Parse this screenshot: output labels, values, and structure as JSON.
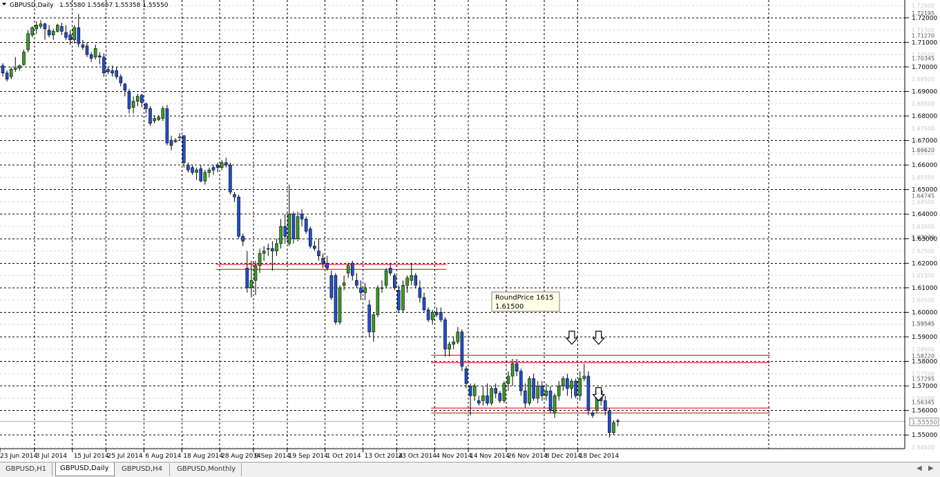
{
  "header": {
    "symbol": "GBPUSD,Daily",
    "ohlc": "1.55580 1.55657 1.55358 1.55550"
  },
  "tooltip": {
    "line1": "RoundPrice 1615",
    "line2": "1.61500"
  },
  "tabs": [
    {
      "label": "GBPUSD,H1",
      "active": false
    },
    {
      "label": "GBPUSD,Daily",
      "active": true
    },
    {
      "label": "GBPUSD,H4",
      "active": false
    },
    {
      "label": "GBPUSD,Monthly",
      "active": false
    }
  ],
  "colors": {
    "bull": "#3a9b26",
    "bear": "#1f4fd1",
    "wick": "#000000",
    "grid": "#000000",
    "level_line": "#cc0000"
  },
  "chart_data": {
    "type": "candlestick",
    "title": "GBPUSD,Daily",
    "ylim": [
      1.545,
      1.725
    ],
    "y_ticks_bold": [
      "1.72000",
      "1.71000",
      "1.70000",
      "1.69000",
      "1.68000",
      "1.67000",
      "1.66000",
      "1.65000",
      "1.64000",
      "1.63000",
      "1.62000",
      "1.61000",
      "1.60000",
      "1.59000",
      "1.58000",
      "1.57000",
      "1.56000",
      "1.55000"
    ],
    "y_ticks_faint": [
      "1.72500",
      "1.71500",
      "1.70500",
      "1.69500",
      "1.68500",
      "1.67500",
      "1.66500",
      "1.65500",
      "1.64500",
      "1.63500",
      "1.62500",
      "1.61500",
      "1.60500",
      "1.59500",
      "1.58500",
      "1.57500",
      "1.56500",
      "1.54500"
    ],
    "y_marker_labels": [
      "1.72195",
      "1.71270",
      "1.70345",
      "1.66620",
      "1.64745",
      "1.63070",
      "1.59545",
      "1.58220",
      "1.57295",
      "1.56345"
    ],
    "current_price": "1.55550",
    "x_tick_labels": [
      "23 Jun 2014",
      "3 Jul 2014",
      "15 Jul 2014",
      "25 Jul 2014",
      "6 Aug 2014",
      "18 Aug 2014",
      "28 Aug 2014",
      "9 Sep 2014",
      "19 Sep 2014",
      "1 Oct 2014",
      "13 Oct 2014",
      "23 Oct 2014",
      "4 Nov 2014",
      "14 Nov 2014",
      "26 Nov 2014",
      "8 Dec 2014",
      "18 Dec 2014"
    ],
    "horizontal_levels": [
      {
        "price": 1.6195,
        "from": "28 Aug 2014",
        "to": "4 Nov 2014"
      },
      {
        "price": 1.6175,
        "from": "28 Aug 2014",
        "to": "4 Nov 2014"
      },
      {
        "price": 1.5825,
        "from": "4 Nov 2014",
        "to": "18 Dec 2014"
      },
      {
        "price": 1.5795,
        "from": "4 Nov 2014",
        "to": "18 Dec 2014"
      },
      {
        "price": 1.561,
        "from": "4 Nov 2014",
        "to": "18 Dec 2014"
      },
      {
        "price": 1.559,
        "from": "4 Nov 2014",
        "to": "18 Dec 2014"
      }
    ],
    "arrows": [
      {
        "label": "down-arrow",
        "price": 1.5895,
        "at": "8 Dec 2014"
      },
      {
        "label": "down-arrow",
        "price": 1.5895,
        "at": "18 Dec 2014"
      },
      {
        "label": "down-arrow",
        "price": 1.5665,
        "at": "18 Dec 2014"
      }
    ],
    "ohlc": [
      [
        1.7005,
        1.7015,
        1.696,
        1.6975
      ],
      [
        1.6975,
        1.6985,
        1.694,
        1.695
      ],
      [
        1.696,
        1.7,
        1.695,
        1.699
      ],
      [
        1.699,
        1.704,
        1.698,
        1.6995
      ],
      [
        1.6995,
        1.701,
        1.6985,
        1.7005
      ],
      [
        1.701,
        1.707,
        1.7005,
        1.706
      ],
      [
        1.707,
        1.715,
        1.706,
        1.7135
      ],
      [
        1.713,
        1.7165,
        1.712,
        1.716
      ],
      [
        1.7155,
        1.7185,
        1.7135,
        1.717
      ],
      [
        1.7165,
        1.719,
        1.7155,
        1.7175
      ],
      [
        1.7175,
        1.718,
        1.711,
        1.7155
      ],
      [
        1.715,
        1.717,
        1.712,
        1.713
      ],
      [
        1.713,
        1.7155,
        1.711,
        1.7145
      ],
      [
        1.7145,
        1.7175,
        1.714,
        1.717
      ],
      [
        1.7165,
        1.718,
        1.713,
        1.7145
      ],
      [
        1.714,
        1.717,
        1.711,
        1.712
      ],
      [
        1.713,
        1.715,
        1.709,
        1.711
      ],
      [
        1.711,
        1.717,
        1.7095,
        1.716
      ],
      [
        1.716,
        1.7215,
        1.708,
        1.7095
      ],
      [
        1.709,
        1.711,
        1.707,
        1.708
      ],
      [
        1.7085,
        1.71,
        1.704,
        1.705
      ],
      [
        1.705,
        1.706,
        1.702,
        1.7035
      ],
      [
        1.704,
        1.709,
        1.703,
        1.7075
      ],
      [
        1.7045,
        1.706,
        1.701,
        1.704
      ],
      [
        1.704,
        1.7055,
        1.696,
        1.6975
      ],
      [
        1.699,
        1.7,
        1.697,
        1.698
      ],
      [
        1.6985,
        1.7005,
        1.696,
        1.6975
      ],
      [
        1.6985,
        1.7,
        1.695,
        1.696
      ],
      [
        1.696,
        1.697,
        1.692,
        1.6935
      ],
      [
        1.693,
        1.6935,
        1.688,
        1.6905
      ],
      [
        1.69,
        1.691,
        1.681,
        1.683
      ],
      [
        1.6835,
        1.688,
        1.681,
        1.686
      ],
      [
        1.686,
        1.689,
        1.684,
        1.688
      ],
      [
        1.6885,
        1.689,
        1.6835,
        1.6855
      ],
      [
        1.685,
        1.6855,
        1.681,
        1.683
      ],
      [
        1.683,
        1.684,
        1.676,
        1.677
      ],
      [
        1.678,
        1.68,
        1.677,
        1.679
      ],
      [
        1.6785,
        1.68,
        1.678,
        1.6795
      ],
      [
        1.679,
        1.684,
        1.678,
        1.683
      ],
      [
        1.683,
        1.6845,
        1.668,
        1.669
      ],
      [
        1.67,
        1.672,
        1.666,
        1.668
      ],
      [
        1.6695,
        1.671,
        1.669,
        1.67
      ],
      [
        1.6715,
        1.673,
        1.67,
        1.6715
      ],
      [
        1.672,
        1.672,
        1.659,
        1.661
      ],
      [
        1.66,
        1.661,
        1.657,
        1.658
      ],
      [
        1.659,
        1.66,
        1.656,
        1.657
      ],
      [
        1.657,
        1.659,
        1.654,
        1.658
      ],
      [
        1.6585,
        1.66,
        1.653,
        1.6535
      ],
      [
        1.6535,
        1.658,
        1.652,
        1.657
      ],
      [
        1.657,
        1.659,
        1.655,
        1.658
      ],
      [
        1.659,
        1.66,
        1.656,
        1.658
      ],
      [
        1.66,
        1.661,
        1.657,
        1.659
      ],
      [
        1.659,
        1.662,
        1.658,
        1.661
      ],
      [
        1.661,
        1.663,
        1.659,
        1.66
      ],
      [
        1.66,
        1.661,
        1.648,
        1.649
      ],
      [
        1.648,
        1.649,
        1.645,
        1.647
      ],
      [
        1.647,
        1.648,
        1.63,
        1.631
      ],
      [
        1.631,
        1.632,
        1.627,
        1.629
      ],
      [
        1.618,
        1.625,
        1.608,
        1.61
      ],
      [
        1.61,
        1.621,
        1.606,
        1.613
      ],
      [
        1.613,
        1.621,
        1.607,
        1.619
      ],
      [
        1.619,
        1.626,
        1.616,
        1.624
      ],
      [
        1.624,
        1.627,
        1.621,
        1.625
      ],
      [
        1.626,
        1.628,
        1.623,
        1.626
      ],
      [
        1.626,
        1.629,
        1.617,
        1.625
      ],
      [
        1.625,
        1.63,
        1.623,
        1.628
      ],
      [
        1.628,
        1.638,
        1.626,
        1.635
      ],
      [
        1.635,
        1.64,
        1.628,
        1.631
      ],
      [
        1.628,
        1.652,
        1.627,
        1.64
      ],
      [
        1.64,
        1.641,
        1.628,
        1.63
      ],
      [
        1.63,
        1.641,
        1.629,
        1.639
      ],
      [
        1.64,
        1.642,
        1.635,
        1.638
      ],
      [
        1.638,
        1.639,
        1.632,
        1.633
      ],
      [
        1.634,
        1.635,
        1.626,
        1.627
      ],
      [
        1.627,
        1.629,
        1.625,
        1.626
      ],
      [
        1.625,
        1.63,
        1.621,
        1.623
      ],
      [
        1.622,
        1.624,
        1.618,
        1.62
      ],
      [
        1.62,
        1.623,
        1.617,
        1.618
      ],
      [
        1.615,
        1.617,
        1.605,
        1.606
      ],
      [
        1.615,
        1.616,
        1.595,
        1.596
      ],
      [
        1.596,
        1.611,
        1.595,
        1.61
      ],
      [
        1.611,
        1.615,
        1.609,
        1.612
      ],
      [
        1.616,
        1.62,
        1.614,
        1.619
      ],
      [
        1.62,
        1.621,
        1.613,
        1.615
      ],
      [
        1.613,
        1.616,
        1.61,
        1.611
      ],
      [
        1.61,
        1.613,
        1.605,
        1.608
      ],
      [
        1.608,
        1.612,
        1.605,
        1.61
      ],
      [
        1.603,
        1.605,
        1.59,
        1.592
      ],
      [
        1.592,
        1.6,
        1.588,
        1.599
      ],
      [
        1.599,
        1.611,
        1.598,
        1.61
      ],
      [
        1.61,
        1.613,
        1.608,
        1.61
      ],
      [
        1.611,
        1.618,
        1.61,
        1.617
      ],
      [
        1.618,
        1.62,
        1.615,
        1.616
      ],
      [
        1.615,
        1.616,
        1.609,
        1.61
      ],
      [
        1.609,
        1.611,
        1.6,
        1.601
      ],
      [
        1.601,
        1.613,
        1.6,
        1.611
      ],
      [
        1.611,
        1.615,
        1.608,
        1.614
      ],
      [
        1.613,
        1.62,
        1.611,
        1.615
      ],
      [
        1.615,
        1.616,
        1.61,
        1.611
      ],
      [
        1.61,
        1.613,
        1.604,
        1.606
      ],
      [
        1.606,
        1.608,
        1.6,
        1.601
      ],
      [
        1.601,
        1.602,
        1.596,
        1.597
      ],
      [
        1.597,
        1.601,
        1.595,
        1.6
      ],
      [
        1.6,
        1.602,
        1.598,
        1.599
      ],
      [
        1.6,
        1.602,
        1.596,
        1.597
      ],
      [
        1.597,
        1.598,
        1.582,
        1.585
      ],
      [
        1.585,
        1.588,
        1.582,
        1.587
      ],
      [
        1.587,
        1.59,
        1.585,
        1.588
      ],
      [
        1.588,
        1.594,
        1.587,
        1.592
      ],
      [
        1.592,
        1.593,
        1.576,
        1.578
      ],
      [
        1.577,
        1.578,
        1.569,
        1.571
      ],
      [
        1.57,
        1.571,
        1.558,
        1.566
      ],
      [
        1.566,
        1.571,
        1.564,
        1.57
      ],
      [
        1.564,
        1.566,
        1.562,
        1.563
      ],
      [
        1.564,
        1.57,
        1.562,
        1.566
      ],
      [
        1.566,
        1.571,
        1.562,
        1.563
      ],
      [
        1.563,
        1.57,
        1.562,
        1.569
      ],
      [
        1.569,
        1.571,
        1.565,
        1.567
      ],
      [
        1.567,
        1.568,
        1.563,
        1.564
      ],
      [
        1.564,
        1.572,
        1.563,
        1.571
      ],
      [
        1.571,
        1.576,
        1.568,
        1.574
      ],
      [
        1.574,
        1.581,
        1.57,
        1.579
      ],
      [
        1.579,
        1.581,
        1.574,
        1.576
      ],
      [
        1.576,
        1.577,
        1.566,
        1.568
      ],
      [
        1.568,
        1.571,
        1.561,
        1.563
      ],
      [
        1.563,
        1.574,
        1.562,
        1.573
      ],
      [
        1.573,
        1.575,
        1.564,
        1.565
      ],
      [
        1.565,
        1.572,
        1.563,
        1.57
      ],
      [
        1.57,
        1.572,
        1.564,
        1.566
      ],
      [
        1.566,
        1.571,
        1.564,
        1.568
      ],
      [
        1.568,
        1.57,
        1.559,
        1.56
      ],
      [
        1.559,
        1.567,
        1.557,
        1.566
      ],
      [
        1.566,
        1.572,
        1.564,
        1.57
      ],
      [
        1.57,
        1.574,
        1.568,
        1.573
      ],
      [
        1.573,
        1.575,
        1.566,
        1.569
      ],
      [
        1.569,
        1.573,
        1.565,
        1.572
      ],
      [
        1.572,
        1.573,
        1.565,
        1.566
      ],
      [
        1.566,
        1.576,
        1.564,
        1.573
      ],
      [
        1.573,
        1.579,
        1.572,
        1.574
      ],
      [
        1.574,
        1.576,
        1.558,
        1.56
      ],
      [
        1.559,
        1.56,
        1.557,
        1.558
      ],
      [
        1.56,
        1.569,
        1.559,
        1.568
      ],
      [
        1.568,
        1.569,
        1.562,
        1.564
      ],
      [
        1.564,
        1.566,
        1.558,
        1.56
      ],
      [
        1.56,
        1.561,
        1.549,
        1.551
      ],
      [
        1.551,
        1.556,
        1.55,
        1.555
      ],
      [
        1.5558,
        1.5566,
        1.5536,
        1.5555
      ]
    ]
  }
}
